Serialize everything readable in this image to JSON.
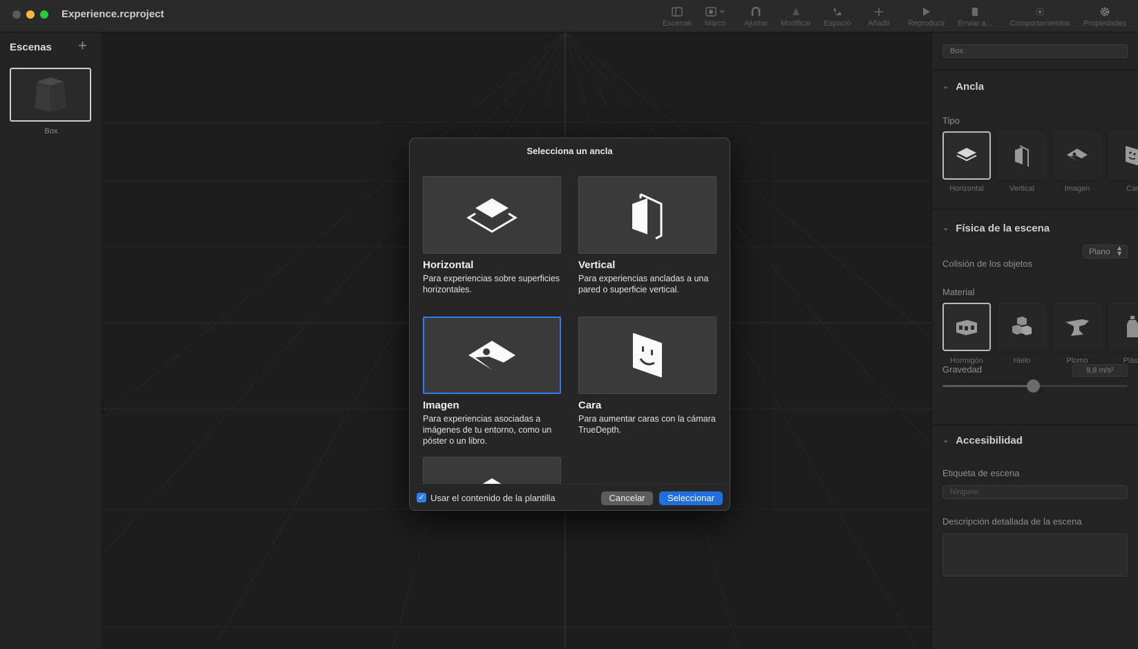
{
  "window": {
    "title": "Experience.rcproject"
  },
  "toolbar": {
    "items": [
      {
        "label": "Escenas",
        "icon": "sidebar-icon"
      },
      {
        "label": "Marco",
        "icon": "frame-icon"
      },
      {
        "label": "Ajustar",
        "icon": "magnet-icon"
      },
      {
        "label": "Modificar",
        "icon": "modify-icon"
      },
      {
        "label": "Espacio",
        "icon": "space-icon"
      },
      {
        "label": "Añadir",
        "icon": "plus-icon"
      },
      {
        "label": "Reproducir",
        "icon": "play-icon"
      },
      {
        "label": "Enviar a...",
        "icon": "phone-icon"
      },
      {
        "label": "Comportamientos",
        "icon": "behaviors-icon"
      },
      {
        "label": "Propiedades",
        "icon": "gear-icon"
      }
    ]
  },
  "sidebar": {
    "title": "Escenas",
    "add_label": "+",
    "scenes": [
      {
        "name": "Box"
      }
    ]
  },
  "inspector": {
    "name_value": "Box",
    "anchor": {
      "header": "Ancla",
      "type_label": "Tipo",
      "types": [
        {
          "label": "Horizontal",
          "icon": "horizontal-plane-icon"
        },
        {
          "label": "Vertical",
          "icon": "vertical-plane-icon"
        },
        {
          "label": "Imagen",
          "icon": "image-anchor-icon"
        },
        {
          "label": "Car",
          "icon": "face-anchor-icon"
        }
      ],
      "selected": "Horizontal"
    },
    "physics": {
      "header": "Física de la escena",
      "collision_label": "Colisión de los objetos",
      "collision_value": "Plano",
      "material_label": "Material",
      "materials": [
        {
          "label": "Hormigón",
          "icon": "concrete-blocks-icon"
        },
        {
          "label": "Hielo",
          "icon": "ice-cubes-icon"
        },
        {
          "label": "Plomo",
          "icon": "anvil-icon"
        },
        {
          "label": "Plásti",
          "icon": "plastic-bottle-icon"
        }
      ],
      "selected_material": "Hormigón",
      "gravity_label": "Gravedad",
      "gravity_value": "9,8 m/s²",
      "gravity_slider_fraction": 0.49
    },
    "accessibility": {
      "header": "Accesibilidad",
      "scene_label_title": "Etiqueta de escena",
      "scene_label_placeholder": "Ninguno",
      "description_title": "Descripción detallada de la escena",
      "description_value": ""
    }
  },
  "dialog": {
    "title": "Selecciona un ancla",
    "options": [
      {
        "title": "Horizontal",
        "description": "Para experiencias sobre superficies horizontales.",
        "icon": "horizontal-plane-icon"
      },
      {
        "title": "Vertical",
        "description": "Para experiencias ancladas a una pared o superficie vertical.",
        "icon": "vertical-plane-icon"
      },
      {
        "title": "Imagen",
        "description": "Para experiencias asociadas a imágenes de tu entorno, como un póster o un libro.",
        "icon": "image-anchor-icon"
      },
      {
        "title": "Cara",
        "description": "Para aumentar caras con la cámara TrueDepth.",
        "icon": "face-anchor-icon"
      }
    ],
    "selected": "Imagen",
    "checkbox_label": "Usar el contenido de la plantilla",
    "checkbox_checked": true,
    "cancel_label": "Cancelar",
    "ok_label": "Seleccionar"
  },
  "colors": {
    "accent": "#2f7ff5",
    "background": "#1e1e1e",
    "panel": "#232323"
  }
}
